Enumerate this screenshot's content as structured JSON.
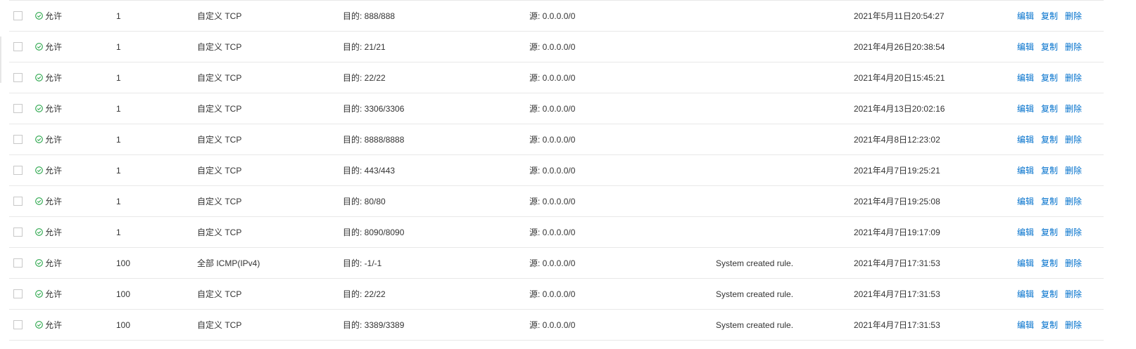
{
  "colors": {
    "link": "#0070cc",
    "allow_icon": "#2fa84f",
    "row_border": "#e8e8e8",
    "text": "#333333"
  },
  "icons": {
    "policy": "check-circle-icon"
  },
  "rules": [
    {
      "policy": "允许",
      "priority": "1",
      "protocol": "自定义 TCP",
      "port_range": "目的: 888/888",
      "source": "源: 0.0.0.0/0",
      "description": "",
      "created": "2021年5月11日20:54:27",
      "actions": {
        "edit": "编辑",
        "copy": "复制",
        "delete": "删除"
      }
    },
    {
      "policy": "允许",
      "priority": "1",
      "protocol": "自定义 TCP",
      "port_range": "目的: 21/21",
      "source": "源: 0.0.0.0/0",
      "description": "",
      "created": "2021年4月26日20:38:54",
      "actions": {
        "edit": "编辑",
        "copy": "复制",
        "delete": "删除"
      }
    },
    {
      "policy": "允许",
      "priority": "1",
      "protocol": "自定义 TCP",
      "port_range": "目的: 22/22",
      "source": "源: 0.0.0.0/0",
      "description": "",
      "created": "2021年4月20日15:45:21",
      "actions": {
        "edit": "编辑",
        "copy": "复制",
        "delete": "删除"
      }
    },
    {
      "policy": "允许",
      "priority": "1",
      "protocol": "自定义 TCP",
      "port_range": "目的: 3306/3306",
      "source": "源: 0.0.0.0/0",
      "description": "",
      "created": "2021年4月13日20:02:16",
      "actions": {
        "edit": "编辑",
        "copy": "复制",
        "delete": "删除"
      }
    },
    {
      "policy": "允许",
      "priority": "1",
      "protocol": "自定义 TCP",
      "port_range": "目的: 8888/8888",
      "source": "源: 0.0.0.0/0",
      "description": "",
      "created": "2021年4月8日12:23:02",
      "actions": {
        "edit": "编辑",
        "copy": "复制",
        "delete": "删除"
      }
    },
    {
      "policy": "允许",
      "priority": "1",
      "protocol": "自定义 TCP",
      "port_range": "目的: 443/443",
      "source": "源: 0.0.0.0/0",
      "description": "",
      "created": "2021年4月7日19:25:21",
      "actions": {
        "edit": "编辑",
        "copy": "复制",
        "delete": "删除"
      }
    },
    {
      "policy": "允许",
      "priority": "1",
      "protocol": "自定义 TCP",
      "port_range": "目的: 80/80",
      "source": "源: 0.0.0.0/0",
      "description": "",
      "created": "2021年4月7日19:25:08",
      "actions": {
        "edit": "编辑",
        "copy": "复制",
        "delete": "删除"
      }
    },
    {
      "policy": "允许",
      "priority": "1",
      "protocol": "自定义 TCP",
      "port_range": "目的: 8090/8090",
      "source": "源: 0.0.0.0/0",
      "description": "",
      "created": "2021年4月7日19:17:09",
      "actions": {
        "edit": "编辑",
        "copy": "复制",
        "delete": "删除"
      }
    },
    {
      "policy": "允许",
      "priority": "100",
      "protocol": "全部 ICMP(IPv4)",
      "port_range": "目的: -1/-1",
      "source": "源: 0.0.0.0/0",
      "description": "System created rule.",
      "created": "2021年4月7日17:31:53",
      "actions": {
        "edit": "编辑",
        "copy": "复制",
        "delete": "删除"
      }
    },
    {
      "policy": "允许",
      "priority": "100",
      "protocol": "自定义 TCP",
      "port_range": "目的: 22/22",
      "source": "源: 0.0.0.0/0",
      "description": "System created rule.",
      "created": "2021年4月7日17:31:53",
      "actions": {
        "edit": "编辑",
        "copy": "复制",
        "delete": "删除"
      }
    },
    {
      "policy": "允许",
      "priority": "100",
      "protocol": "自定义 TCP",
      "port_range": "目的: 3389/3389",
      "source": "源: 0.0.0.0/0",
      "description": "System created rule.",
      "created": "2021年4月7日17:31:53",
      "actions": {
        "edit": "编辑",
        "copy": "复制",
        "delete": "删除"
      }
    }
  ]
}
